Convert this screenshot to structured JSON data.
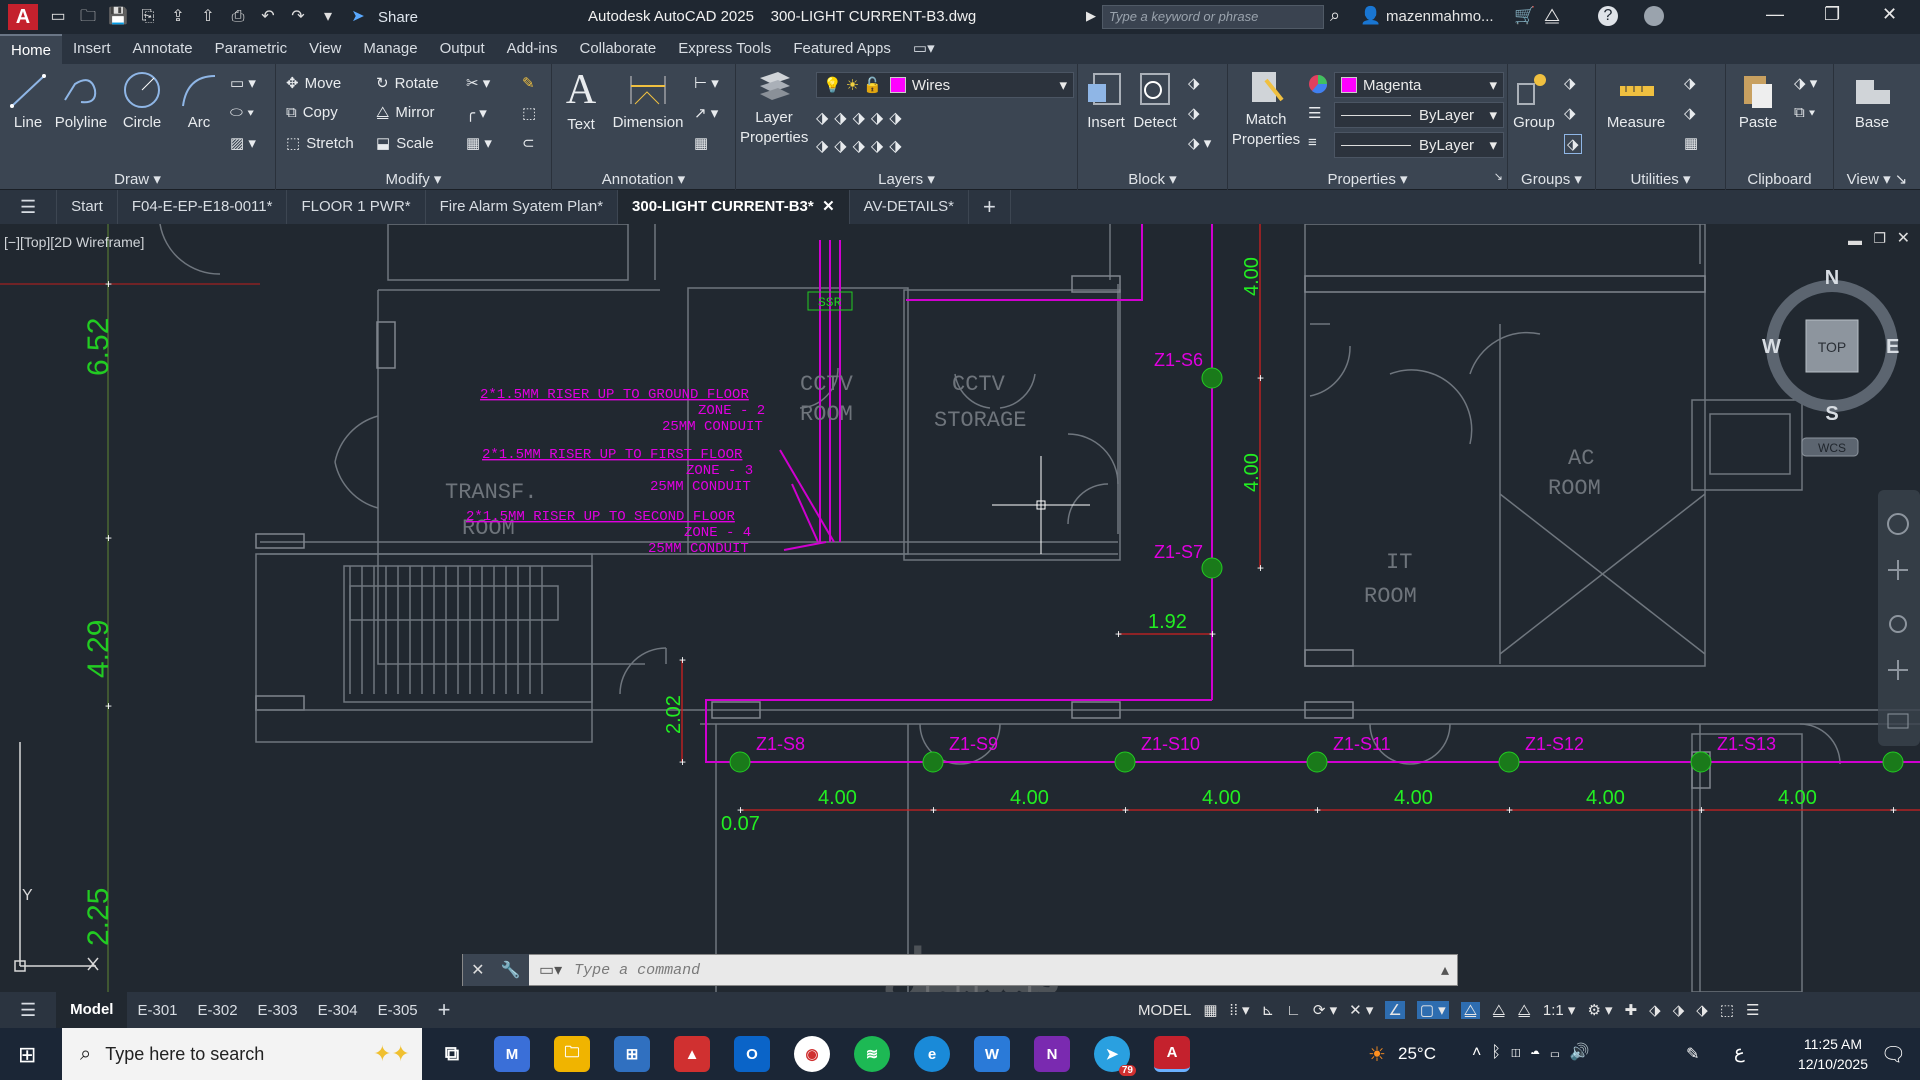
{
  "titlebar": {
    "app_title": "Autodesk AutoCAD 2025",
    "file_title": "300-LIGHT CURRENT-B3.dwg",
    "share_label": "Share",
    "search_placeholder": "Type a keyword or phrase",
    "user": "mazenmahmo..."
  },
  "menu": {
    "tabs": [
      "Home",
      "Insert",
      "Annotate",
      "Parametric",
      "View",
      "Manage",
      "Output",
      "Add-ins",
      "Collaborate",
      "Express Tools",
      "Featured Apps"
    ]
  },
  "ribbon": {
    "draw": {
      "title": "Draw",
      "line": "Line",
      "polyline": "Polyline",
      "circle": "Circle",
      "arc": "Arc"
    },
    "modify": {
      "title": "Modify",
      "move": "Move",
      "rotate": "Rotate",
      "copy": "Copy",
      "mirror": "Mirror",
      "stretch": "Stretch",
      "scale": "Scale"
    },
    "annotation": {
      "title": "Annotation",
      "text": "Text",
      "dimension": "Dimension"
    },
    "layers": {
      "title": "Layers",
      "layer_properties_1": "Layer",
      "layer_properties_2": "Properties",
      "current_layer": "Wires",
      "layer_color": "#ff00ff"
    },
    "block": {
      "title": "Block",
      "insert": "Insert",
      "detect": "Detect"
    },
    "properties": {
      "title": "Properties",
      "match_1": "Match",
      "match_2": "Properties",
      "color": "Magenta",
      "linetype": "ByLayer",
      "lineweight": "ByLayer"
    },
    "groups": {
      "title": "Groups",
      "group": "Group"
    },
    "utilities": {
      "title": "Utilities",
      "measure": "Measure"
    },
    "clipboard": {
      "title": "Clipboard",
      "paste": "Paste"
    },
    "view": {
      "title": "View",
      "base": "Base"
    }
  },
  "filetabs": {
    "items": [
      "Start",
      "F04-E-EP-E18-0011*",
      "FLOOR 1 PWR*",
      "Fire Alarm Syatem Plan*",
      "300-LIGHT CURRENT-B3*",
      "AV-DETAILS*"
    ]
  },
  "viewport": {
    "label": "[−][Top][2D Wireframe]",
    "viewcube": {
      "n": "N",
      "s": "S",
      "e": "E",
      "w": "W",
      "top": "TOP",
      "wcs": "WCS"
    }
  },
  "drawing": {
    "rooms": {
      "transf_1": "TRANSF.",
      "transf_2": "ROOM",
      "cctv_room_1": "CCTV",
      "cctv_room_2": "ROOM",
      "cctv_storage_1": "CCTV",
      "cctv_storage_2": "STORAGE",
      "it_1": "IT",
      "it_2": "ROOM",
      "ac_1": "AC",
      "ac_2": "ROOM",
      "ssr": "SSR"
    },
    "riser_notes": [
      {
        "l1": "2*1.5MM RISER UP TO GROUND FLOOR",
        "l2": "ZONE - 2",
        "l3": "25MM CONDUIT"
      },
      {
        "l1": "2*1.5MM RISER UP TO FIRST FLOOR",
        "l2": "ZONE - 3",
        "l3": "25MM CONDUIT"
      },
      {
        "l1": "2*1.5MM RISER UP TO SECOND FLOOR",
        "l2": "ZONE - 4",
        "l3": "25MM CONDUIT"
      }
    ],
    "detectors": [
      "Z1-S6",
      "Z1-S7",
      "Z1-S8",
      "Z1-S9",
      "Z1-S10",
      "Z1-S11",
      "Z1-S12",
      "Z1-S13"
    ],
    "dims": {
      "left_1": "6.52",
      "left_2": "4.29",
      "left_3": "2.25",
      "vert_1": "4.00",
      "vert_2": "4.00",
      "d192": "1.92",
      "d202": "2.02",
      "d007": "0.07",
      "horiz": [
        "4.00",
        "4.00",
        "4.00",
        "4.00",
        "4.00",
        "4.00"
      ]
    },
    "ucs_y": "Y"
  },
  "cmdline": {
    "placeholder": "Type a command"
  },
  "statusbar": {
    "layout_tabs": [
      "Model",
      "E-301",
      "E-302",
      "E-303",
      "E-304",
      "E-305"
    ],
    "model_label": "MODEL",
    "scale": "1:1"
  },
  "taskbar": {
    "search_placeholder": "Type here to search",
    "temperature": "25°C",
    "time": "11:25 AM",
    "date": "12/10/2025",
    "lang": "ع",
    "telegram_badge": "79"
  },
  "watermark": {
    "line1": "مستقل",
    "line2": "mostaql.com"
  }
}
